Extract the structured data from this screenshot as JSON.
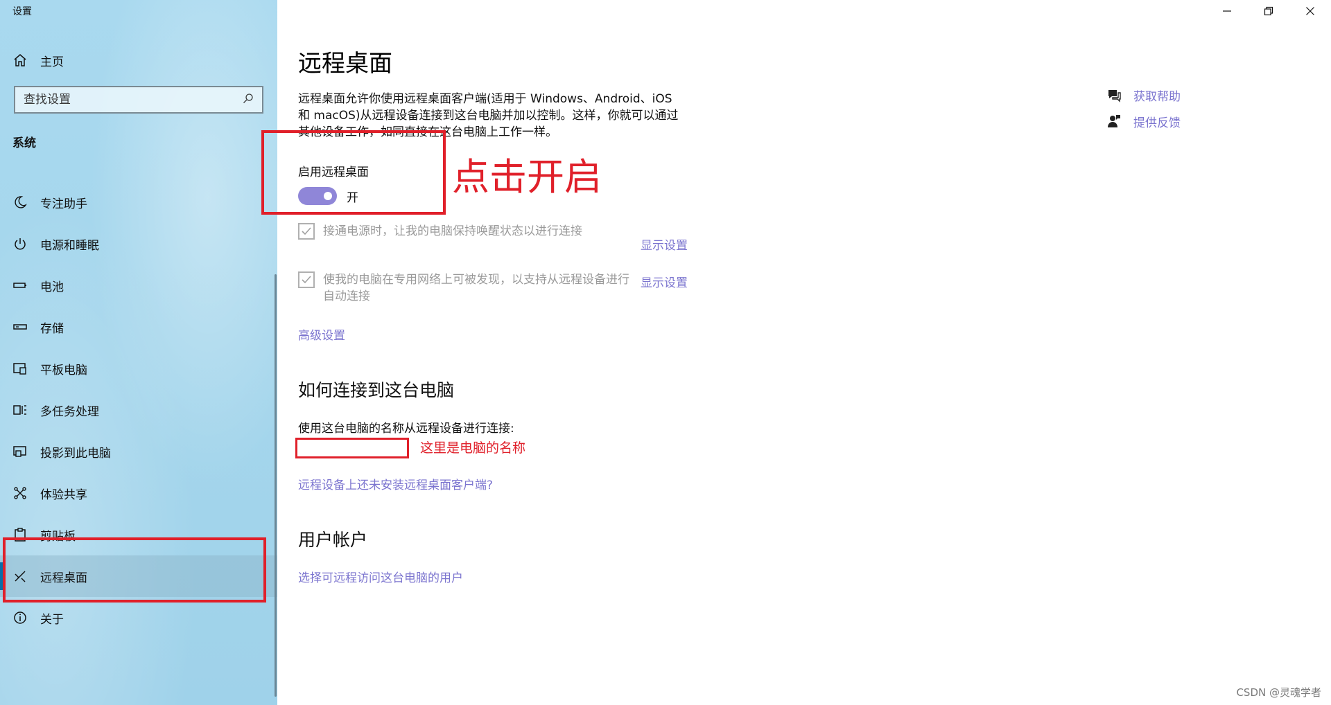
{
  "window": {
    "title": "设置",
    "controls": [
      "minimize",
      "restore",
      "close"
    ]
  },
  "sidebar": {
    "home_label": "主页",
    "search_placeholder": "查找设置",
    "section_title": "系统",
    "items": [
      {
        "label": "专注助手",
        "icon": "moon-icon"
      },
      {
        "label": "电源和睡眠",
        "icon": "power-icon"
      },
      {
        "label": "电池",
        "icon": "battery-icon"
      },
      {
        "label": "存储",
        "icon": "storage-icon"
      },
      {
        "label": "平板电脑",
        "icon": "tablet-icon"
      },
      {
        "label": "多任务处理",
        "icon": "multitask-icon"
      },
      {
        "label": "投影到此电脑",
        "icon": "project-icon"
      },
      {
        "label": "体验共享",
        "icon": "share-icon"
      },
      {
        "label": "剪贴板",
        "icon": "clipboard-icon"
      },
      {
        "label": "远程桌面",
        "icon": "remote-desktop-icon",
        "active": true
      },
      {
        "label": "关于",
        "icon": "info-icon"
      }
    ]
  },
  "main": {
    "title": "远程桌面",
    "description_line1": "远程桌面允许你使用远程桌面客户端(适用于 Windows、Android、iOS",
    "description_line2": "和 macOS)从远程设备连接到这台电脑并加以控制。这样，你就可以通过",
    "description_line3": "其他设备工作，如同直接在这台电脑上工作一样。",
    "toggle_label": "启用远程桌面",
    "toggle_state": "开",
    "toggle_on": true,
    "option1_text": "接通电源时，让我的电脑保持唤醒状态以进行连接",
    "option1_link": "显示设置",
    "option2_text": "使我的电脑在专用网络上可被发现，以支持从远程设备进行自动连接",
    "option2_link": "显示设置",
    "advanced_link": "高级设置",
    "connect_heading": "如何连接到这台电脑",
    "connect_text": "使用这台电脑的名称从远程设备进行连接:",
    "no_client_link": "远程设备上还未安装远程桌面客户端?",
    "accounts_heading": "用户帐户",
    "accounts_link": "选择可远程访问这台电脑的用户"
  },
  "help": {
    "get_help": "获取帮助",
    "feedback": "提供反馈"
  },
  "annotations": {
    "toggle_note": "点击开启",
    "name_note": "这里是电脑的名称",
    "color": "#e0202a"
  },
  "watermark": "CSDN @灵魂学者"
}
